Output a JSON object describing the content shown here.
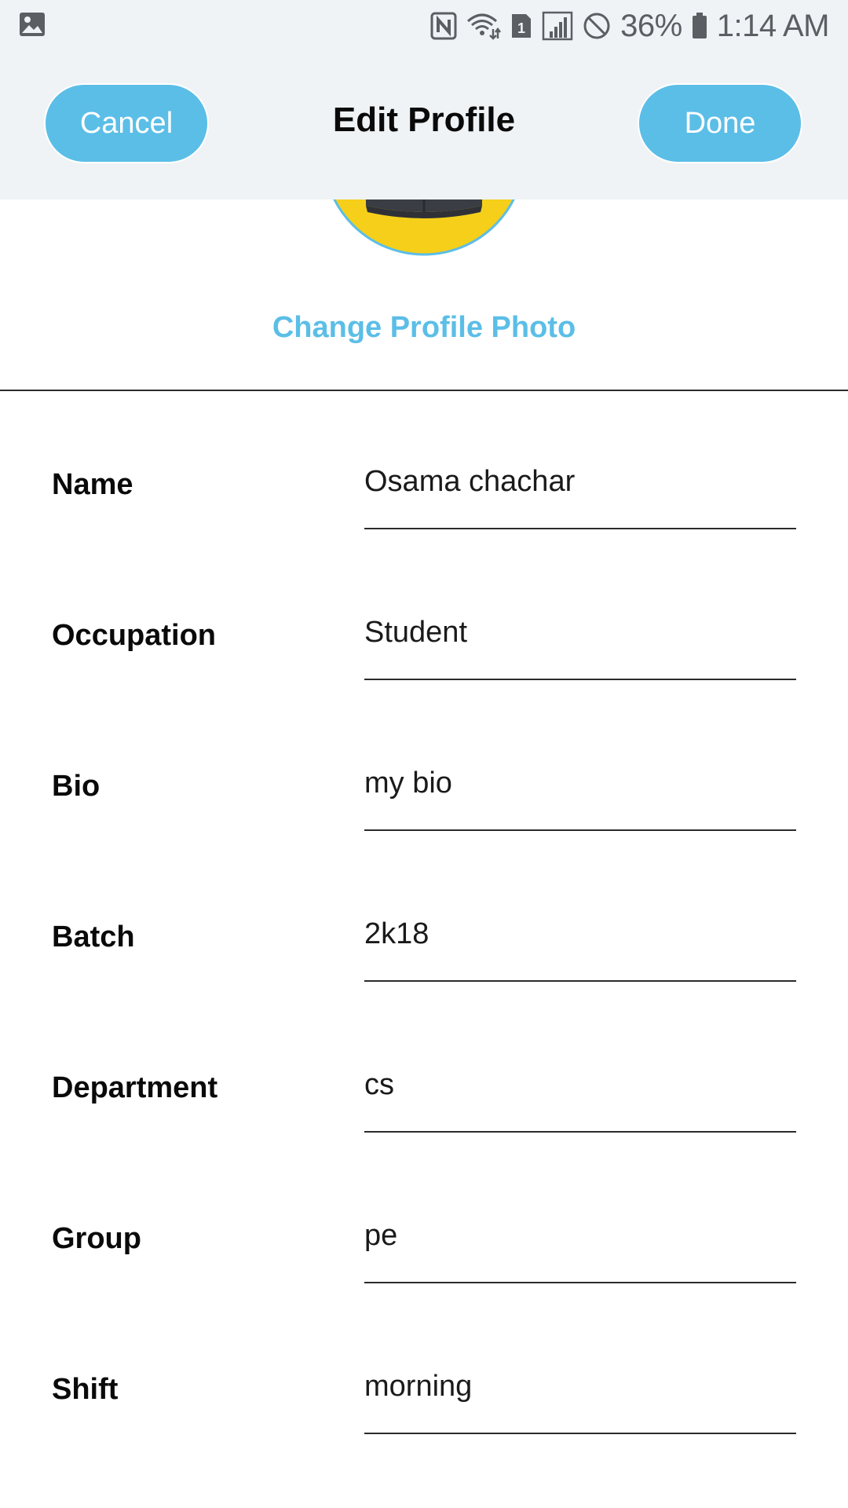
{
  "status_bar": {
    "battery_percent": "36%",
    "time": "1:14 AM",
    "notification_icon": "image-icon",
    "icons": [
      "nfc-icon",
      "wifi-icon",
      "sim-1-icon",
      "signal-icon",
      "do-not-disturb-icon",
      "battery-icon"
    ]
  },
  "header": {
    "title": "Edit Profile",
    "cancel_label": "Cancel",
    "done_label": "Done"
  },
  "profile": {
    "change_photo_label": "Change Profile Photo"
  },
  "fields": [
    {
      "label": "Name",
      "value": "Osama chachar"
    },
    {
      "label": "Occupation",
      "value": "Student"
    },
    {
      "label": "Bio",
      "value": "my bio"
    },
    {
      "label": "Batch",
      "value": "2k18"
    },
    {
      "label": "Department",
      "value": "cs"
    },
    {
      "label": "Group",
      "value": "pe"
    },
    {
      "label": "Shift",
      "value": "morning"
    }
  ],
  "colors": {
    "accent": "#5bbee7",
    "header_bg": "#eff3f6",
    "avatar_yellow": "#f5cf1a"
  }
}
